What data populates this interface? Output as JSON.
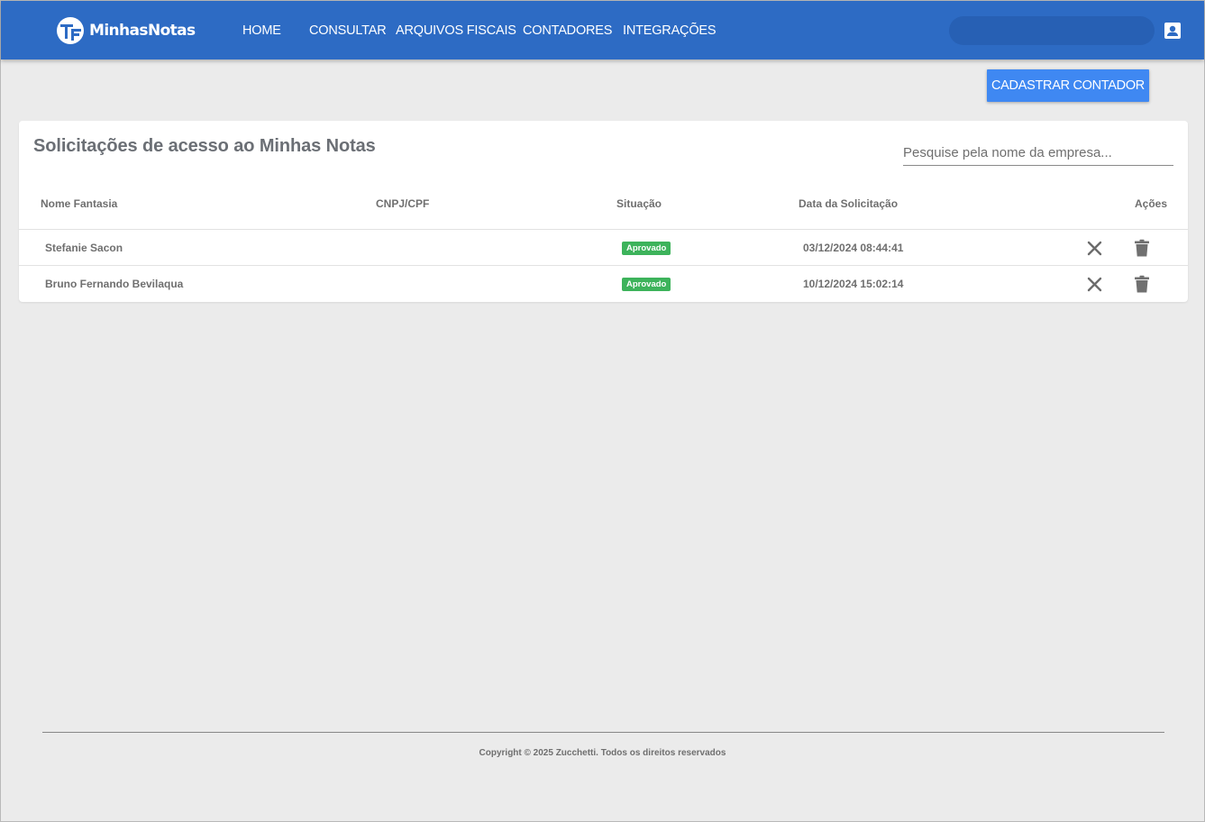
{
  "brand": {
    "name": "MinhasNotas",
    "primary_color": "#2d6bc4",
    "accent_color": "#3f88f2",
    "badge_color": "#3db35b"
  },
  "nav": {
    "items": [
      {
        "label": "HOME"
      },
      {
        "label": "CONSULTAR"
      },
      {
        "label": "ARQUIVOS FISCAIS"
      },
      {
        "label": "CONTADORES"
      },
      {
        "label": "INTEGRAÇÕES"
      }
    ],
    "account_icon": "account-box-icon"
  },
  "toolbar": {
    "register_label": "CADASTRAR CONTADOR"
  },
  "card": {
    "title": "Solicitações de acesso ao Minhas Notas",
    "search_placeholder": "Pesquise pela nome da empresa...",
    "columns": {
      "name": "Nome Fantasia",
      "doc": "CNPJ/CPF",
      "status": "Situação",
      "date": "Data da Solicitação",
      "actions": "Ações"
    },
    "rows": [
      {
        "name": "Stefanie Sacon",
        "doc": "",
        "status": "Aprovado",
        "date": "03/12/2024 08:44:41"
      },
      {
        "name": "Bruno Fernando Bevilaqua",
        "doc": "",
        "status": "Aprovado",
        "date": "10/12/2024 15:02:14"
      }
    ]
  },
  "footer": {
    "copyright": "Copyright © 2025 Zucchetti. Todos os direitos reservados"
  }
}
